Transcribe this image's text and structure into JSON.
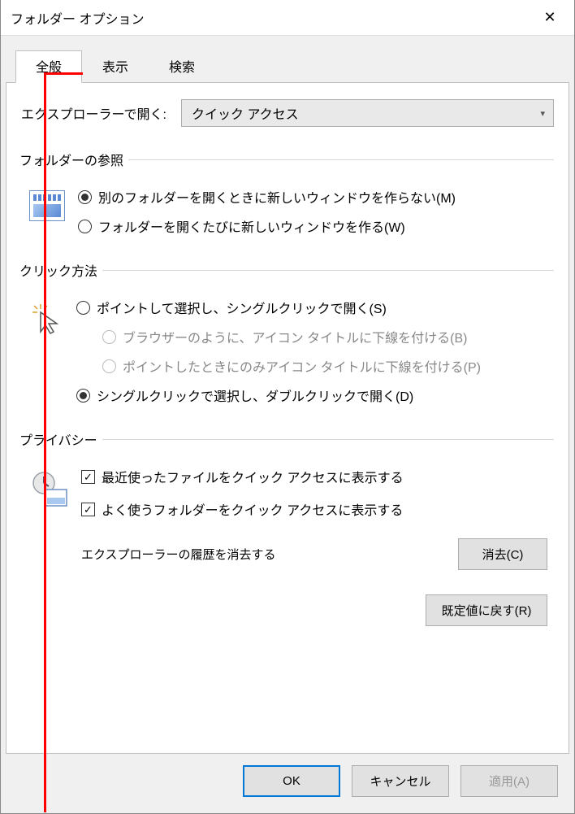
{
  "title": "フォルダー オプション",
  "tabs": [
    "全般",
    "表示",
    "検索"
  ],
  "activeTab": 0,
  "openWith": {
    "label": "エクスプローラーで開く:",
    "value": "クイック アクセス"
  },
  "groups": {
    "browse": {
      "legend": "フォルダーの参照",
      "options": [
        {
          "label": "別のフォルダーを開くときに新しいウィンドウを作らない(M)",
          "checked": true
        },
        {
          "label": "フォルダーを開くたびに新しいウィンドウを作る(W)",
          "checked": false
        }
      ]
    },
    "click": {
      "legend": "クリック方法",
      "options": [
        {
          "label": "ポイントして選択し、シングルクリックで開く(S)",
          "checked": false
        },
        {
          "label": "ブラウザーのように、アイコン タイトルに下線を付ける(B)",
          "checked": false,
          "sub": true,
          "disabled": true
        },
        {
          "label": "ポイントしたときにのみアイコン タイトルに下線を付ける(P)",
          "checked": false,
          "sub": true,
          "disabled": true
        },
        {
          "label": "シングルクリックで選択し、ダブルクリックで開く(D)",
          "checked": true
        }
      ]
    },
    "privacy": {
      "legend": "プライバシー",
      "checks": [
        {
          "label": "最近使ったファイルをクイック アクセスに表示する",
          "checked": true
        },
        {
          "label": "よく使うフォルダーをクイック アクセスに表示する",
          "checked": true
        }
      ],
      "clearLabel": "エクスプローラーの履歴を消去する",
      "clearBtn": "消去(C)"
    }
  },
  "restoreBtn": "既定値に戻す(R)",
  "buttons": {
    "ok": "OK",
    "cancel": "キャンセル",
    "apply": "適用(A)"
  }
}
